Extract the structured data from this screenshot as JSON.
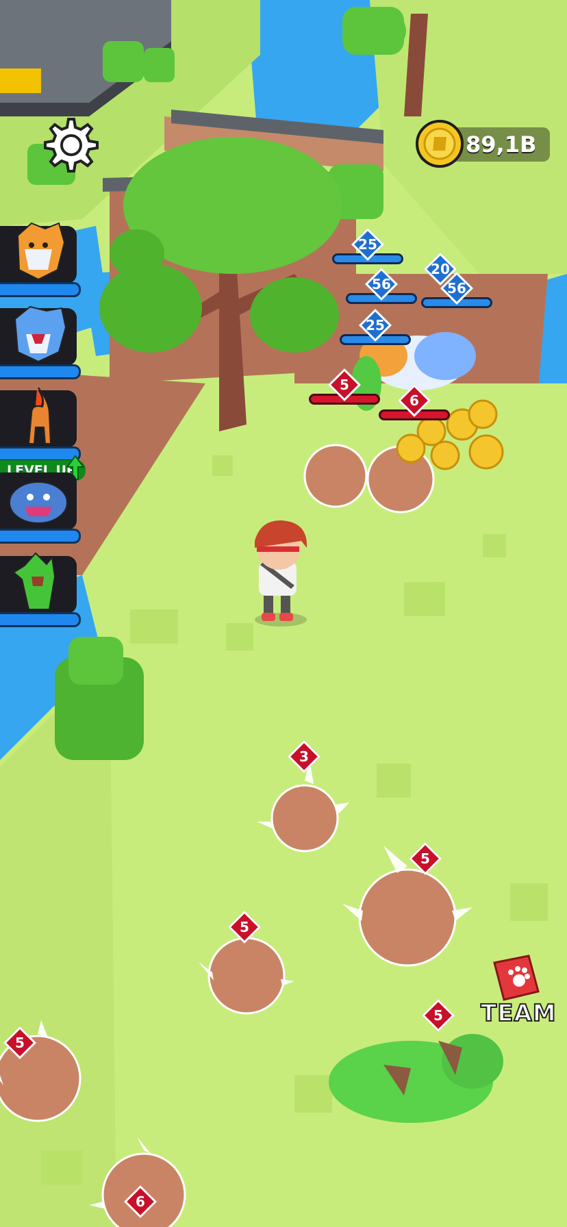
{
  "hud": {
    "currency_value": "89,1B",
    "coin_icon": "gold-coin-icon",
    "settings_icon": "gear-icon"
  },
  "team_panel": {
    "level_up_label": "LEVEL UP",
    "monsters": [
      {
        "name": "orange-werewolf"
      },
      {
        "name": "blue-werewolf"
      },
      {
        "name": "fire-horse"
      },
      {
        "name": "blue-golem"
      },
      {
        "name": "green-cactus-monster"
      }
    ]
  },
  "ally_badges": [
    {
      "level": "25"
    },
    {
      "level": "56"
    },
    {
      "level": "20"
    },
    {
      "level": "56"
    },
    {
      "level": "25"
    }
  ],
  "enemy_badges": [
    {
      "level": "5"
    },
    {
      "level": "6"
    },
    {
      "level": "3"
    },
    {
      "level": "5"
    },
    {
      "level": "5"
    },
    {
      "level": "5"
    },
    {
      "level": "5"
    },
    {
      "level": "6"
    }
  ],
  "team_button": {
    "label": "TEAM",
    "icon": "paw-book-icon"
  },
  "colors": {
    "grass": "#c8ec7c",
    "water": "#36a6f0",
    "enemy_badge": "#c8102a",
    "ally_badge": "#1e6fd0"
  }
}
